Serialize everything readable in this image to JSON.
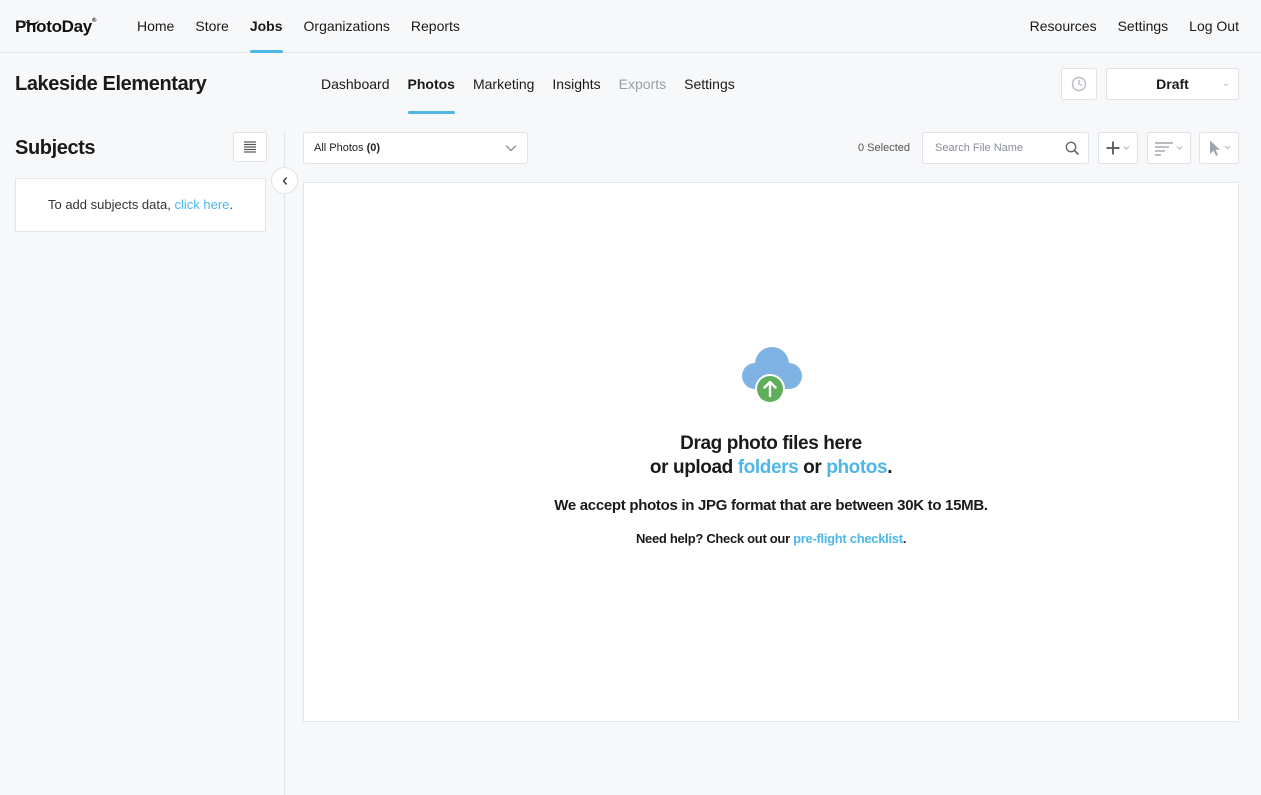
{
  "brand": {
    "name": "PhotoDay",
    "mark": "®"
  },
  "nav": {
    "main": [
      {
        "label": "Home",
        "active": false
      },
      {
        "label": "Store",
        "active": false
      },
      {
        "label": "Jobs",
        "active": true
      },
      {
        "label": "Organizations",
        "active": false
      },
      {
        "label": "Reports",
        "active": false
      }
    ],
    "right": [
      {
        "label": "Resources"
      },
      {
        "label": "Settings"
      },
      {
        "label": "Log Out"
      }
    ]
  },
  "job": {
    "title": "Lakeside Elementary",
    "tabs": [
      {
        "label": "Dashboard",
        "state": "normal"
      },
      {
        "label": "Photos",
        "state": "active"
      },
      {
        "label": "Marketing",
        "state": "normal"
      },
      {
        "label": "Insights",
        "state": "normal"
      },
      {
        "label": "Exports",
        "state": "disabled"
      },
      {
        "label": "Settings",
        "state": "normal"
      }
    ],
    "status": "Draft"
  },
  "sidebar": {
    "title": "Subjects",
    "empty_prefix": "To add subjects data, ",
    "empty_link": "click here",
    "empty_suffix": "."
  },
  "toolbar": {
    "filter_label": "All Photos",
    "filter_count": "(0)",
    "selected": "0 Selected",
    "search_placeholder": "Search File Name"
  },
  "dropzone": {
    "line1": "Drag photo files here",
    "line2_prefix": "or upload ",
    "folders_link": "folders",
    "line2_mid": " or ",
    "photos_link": "photos",
    "line2_suffix": ".",
    "line3": "We accept photos in JPG format that are between 30K to 15MB.",
    "help_prefix": "Need help? Check out our ",
    "help_link": "pre-flight checklist",
    "help_suffix": "."
  },
  "colors": {
    "accent": "#4fb7e8",
    "cloud": "#7fb3e3",
    "upload_arrow": "#5fae5a",
    "border": "#dfe2e6",
    "background": "#f7f8fa"
  },
  "icons": {
    "history": "clock-icon",
    "list": "list-icon",
    "collapse": "chevron-left-icon",
    "search": "search-icon",
    "add": "plus-icon",
    "sort": "sort-icon",
    "select": "cursor-icon",
    "upload": "cloud-upload-icon"
  }
}
